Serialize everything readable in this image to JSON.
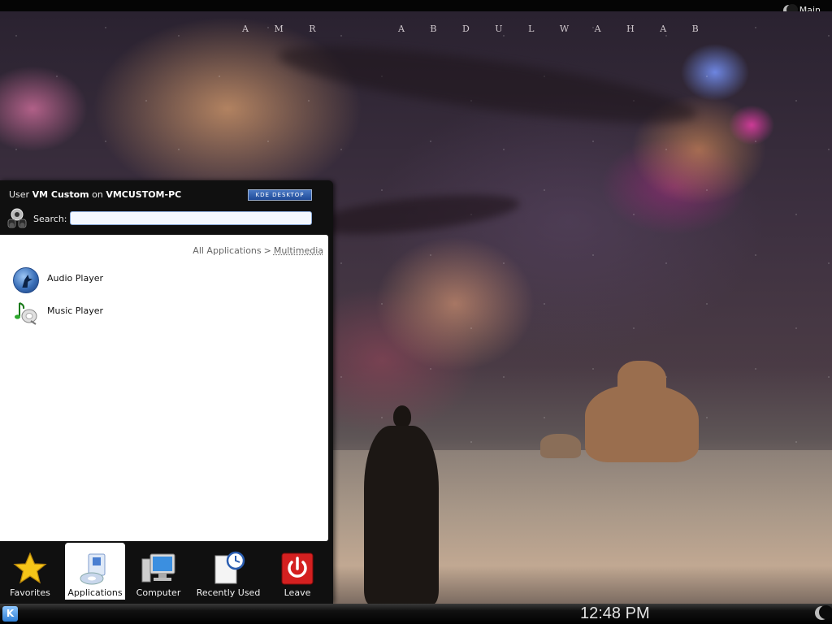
{
  "desktop": {
    "signature_text": "A M R     A B D U L W A H A B"
  },
  "top_panel": {
    "activity_label": "Main"
  },
  "kickoff": {
    "user_prefix": "User",
    "user_name": "VM Custom",
    "on_text": "on",
    "host_name": "VMCUSTOM-PC",
    "kde_logo_text": "KDE DESKTOP",
    "search_label": "Search:",
    "search_value": "",
    "breadcrumb": {
      "root": "All Applications",
      "separator": ">",
      "current": "Multimedia"
    },
    "items": [
      {
        "label": "Audio Player",
        "icon": "audio-player-icon"
      },
      {
        "label": "Music Player",
        "icon": "music-player-icon"
      }
    ],
    "tabs": [
      {
        "label": "Favorites",
        "icon": "star-icon",
        "active": false
      },
      {
        "label": "Applications",
        "icon": "applications-icon",
        "active": true
      },
      {
        "label": "Computer",
        "icon": "computer-icon",
        "active": false
      },
      {
        "label": "Recently Used",
        "icon": "recently-used-icon",
        "active": false
      },
      {
        "label": "Leave",
        "icon": "power-icon",
        "active": false
      }
    ]
  },
  "bottom_panel": {
    "clock": "12:48 PM",
    "kmenu_glyph": "K"
  },
  "colors": {
    "menu_background": "#101010",
    "content_background": "#ffffff",
    "search_border": "#88a7d6",
    "leave_red": "#d42020"
  }
}
